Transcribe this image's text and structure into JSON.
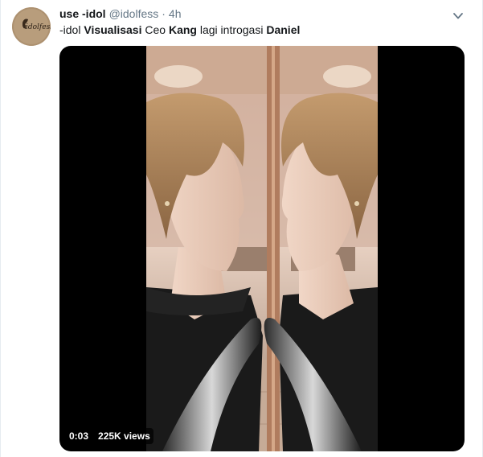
{
  "author": {
    "display_name": "use -idol",
    "handle": "@idolfess",
    "separator": "·",
    "time": "4h",
    "avatar_text": "idolfess"
  },
  "tweet": {
    "text_parts": [
      {
        "text": "-idol ",
        "bold": false
      },
      {
        "text": "Visualisasi",
        "bold": true
      },
      {
        "text": " Ceo ",
        "bold": false
      },
      {
        "text": "Kang",
        "bold": true
      },
      {
        "text": " lagi introgasi ",
        "bold": false
      },
      {
        "text": "Daniel",
        "bold": true
      }
    ]
  },
  "video": {
    "duration": "0:03",
    "views": "225K views"
  },
  "icons": {
    "menu": "chevron-down-icon",
    "avatar": "avatar-logo"
  },
  "colors": {
    "name": "#14171a",
    "muted": "#657786",
    "media_bg": "#000000"
  }
}
